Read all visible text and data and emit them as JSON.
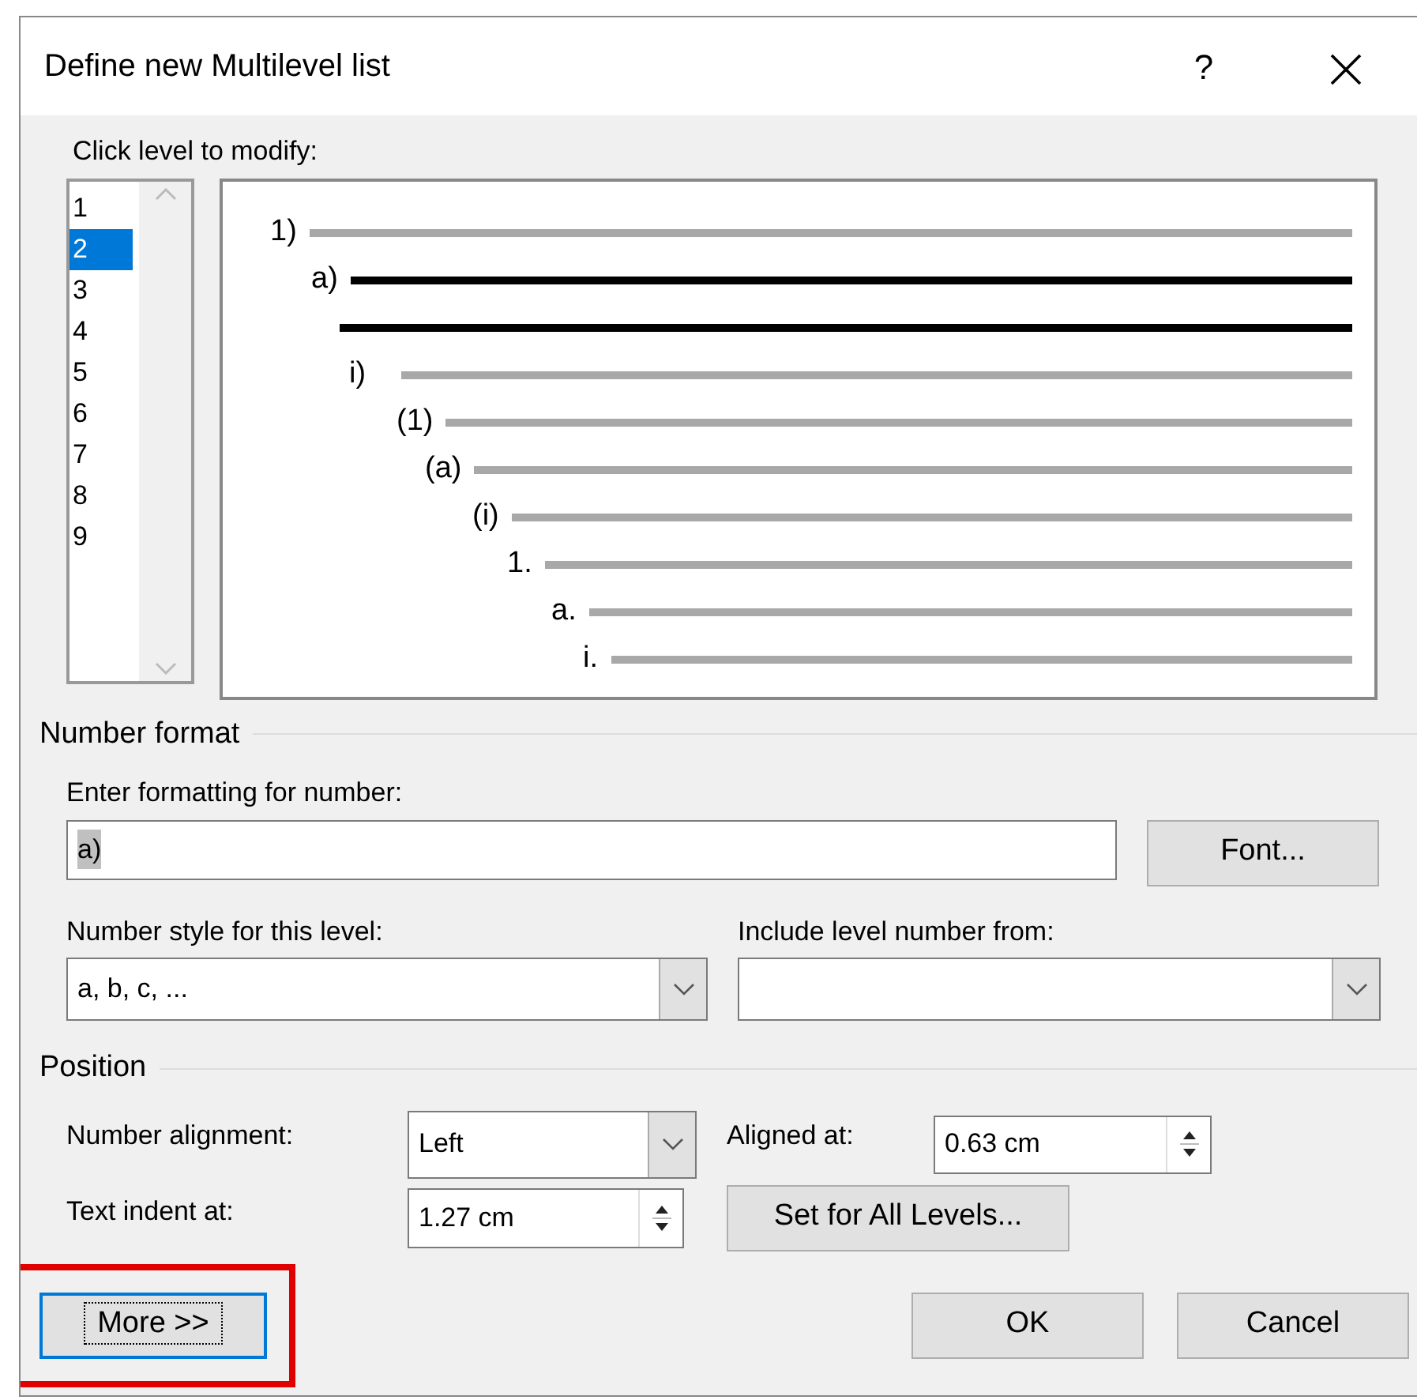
{
  "window": {
    "title": "Define new Multilevel list",
    "help": "?"
  },
  "level_list": {
    "label": "Click level to modify:",
    "items": [
      {
        "label": "1",
        "selected": false
      },
      {
        "label": "2",
        "selected": true
      },
      {
        "label": "3",
        "selected": false
      },
      {
        "label": "4",
        "selected": false
      },
      {
        "label": "5",
        "selected": false
      },
      {
        "label": "6",
        "selected": false
      },
      {
        "label": "7",
        "selected": false
      },
      {
        "label": "8",
        "selected": false
      },
      {
        "label": "9",
        "selected": false
      }
    ]
  },
  "preview": [
    {
      "label": "1)",
      "selected": false
    },
    {
      "label": "a)",
      "selected": true
    },
    {
      "label": "i)",
      "selected": false
    },
    {
      "label": "(1)",
      "selected": false
    },
    {
      "label": "(a)",
      "selected": false
    },
    {
      "label": "(i)",
      "selected": false
    },
    {
      "label": "1.",
      "selected": false
    },
    {
      "label": "a.",
      "selected": false
    },
    {
      "label": "i.",
      "selected": false
    }
  ],
  "number_format": {
    "title": "Number format",
    "format_label": "Enter formatting for number:",
    "format_value": "a)",
    "font_button": "Font...",
    "style_label": "Number style for this level:",
    "style_value": "a, b, c, ...",
    "include_label": "Include level number from:"
  },
  "position": {
    "title": "Position",
    "alignment_label": "Number alignment:",
    "alignment_value": "Left",
    "aligned_at_label": "Aligned at:",
    "aligned_at_value": "0.63 cm",
    "indent_label": "Text indent at:",
    "indent_value": "1.27 cm",
    "set_all_button": "Set for All Levels..."
  },
  "buttons": [
    {
      "label": "More >>",
      "highlighted": true
    },
    {
      "label": "OK",
      "highlighted": false
    },
    {
      "label": "Cancel",
      "highlighted": false
    }
  ]
}
